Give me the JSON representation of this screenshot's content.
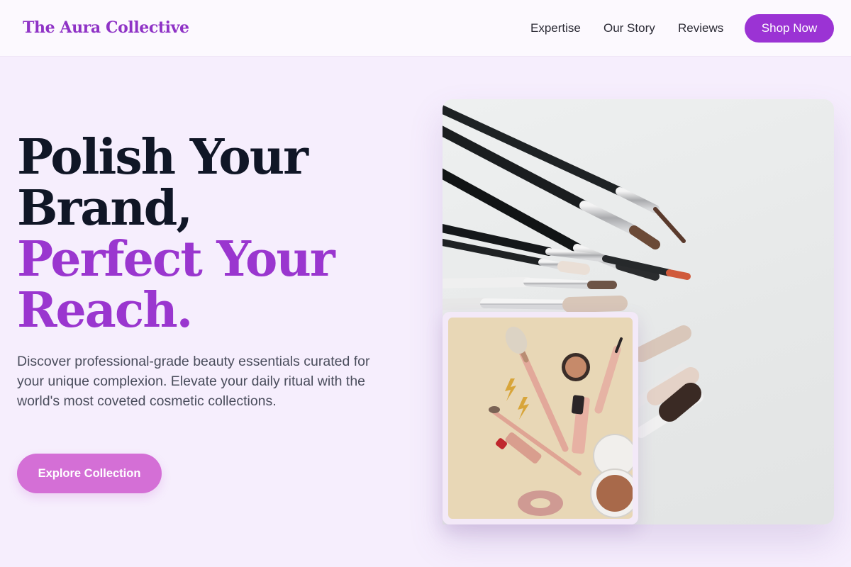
{
  "header": {
    "logo": "The Aura Collective",
    "nav": {
      "expertise": "Expertise",
      "our_story": "Our Story",
      "reviews": "Reviews"
    },
    "cta": "Shop Now"
  },
  "hero": {
    "headline": {
      "line1": "Polish Your",
      "line2": "Brand,",
      "line3": "Perfect Your",
      "line4": "Reach."
    },
    "description": "Discover professional-grade beauty essentials curated for your unique complexion. Elevate your daily ritual with the world's most coveted cosmetic collections.",
    "cta": "Explore Collection"
  },
  "images": {
    "main": "makeup-brushes-photo",
    "inset": "cosmetics-flatlay-photo"
  },
  "colors": {
    "accent": "#9b33d4",
    "headline_dark": "#101626",
    "headline_accent": "#9a36cf",
    "button_pink": "#d46fd6",
    "page_bg": "#f6eefd"
  }
}
